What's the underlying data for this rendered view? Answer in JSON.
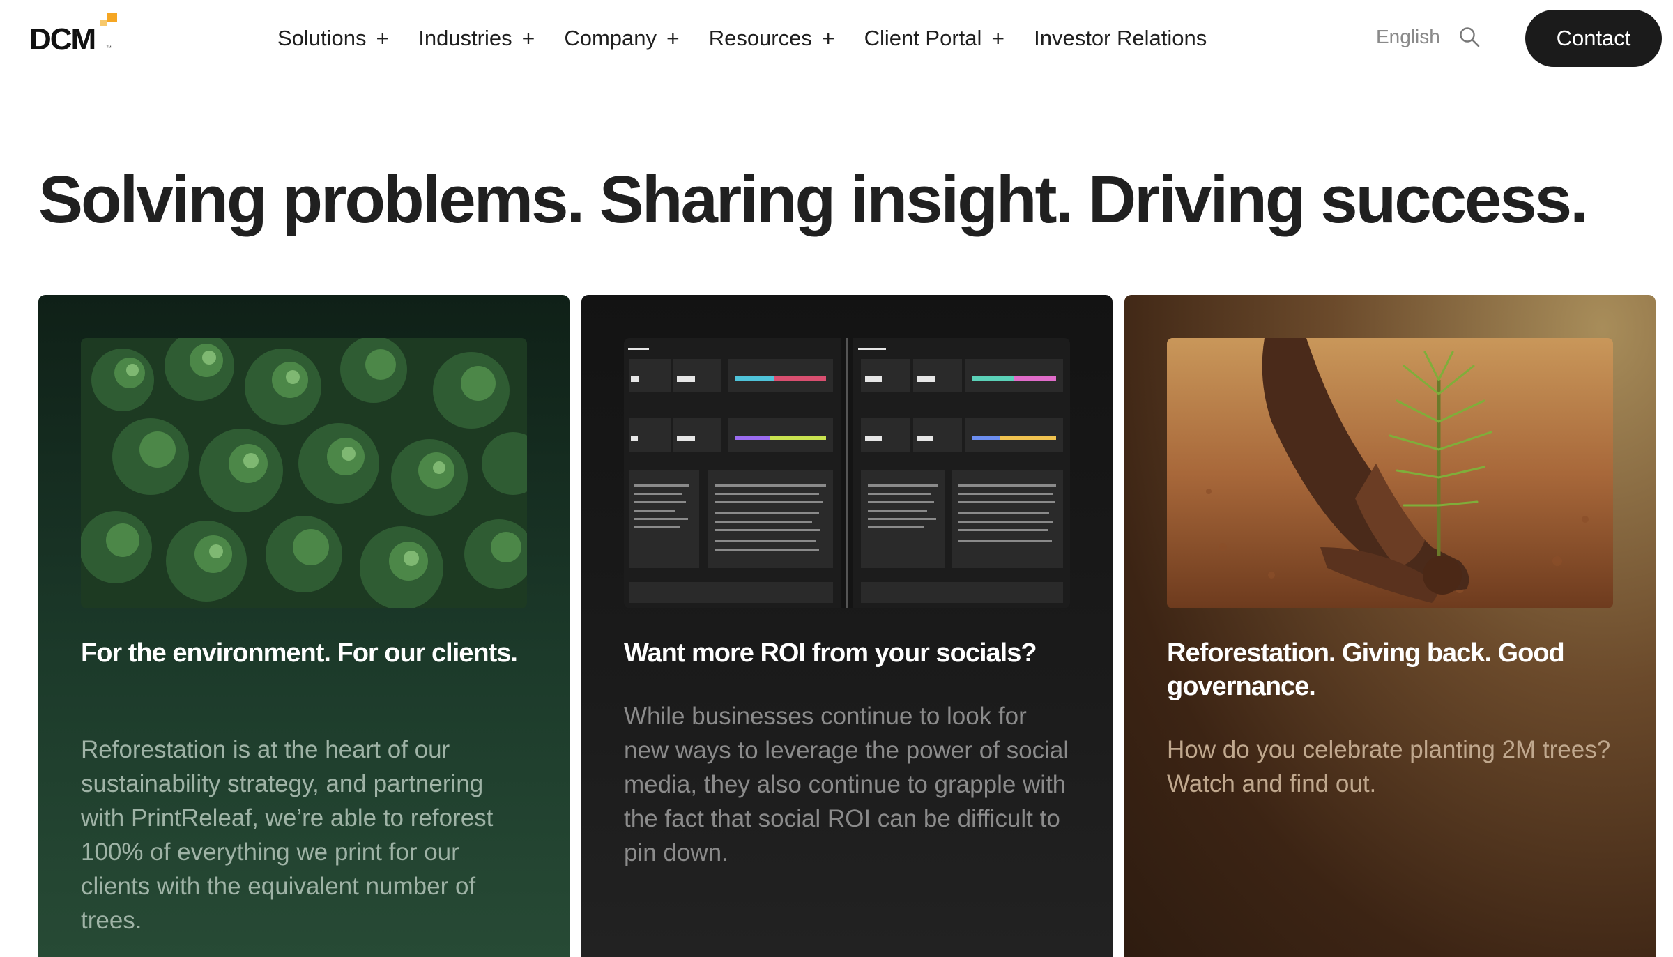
{
  "nav": {
    "logo": "DCM",
    "items": [
      {
        "label": "Solutions",
        "has_submenu": true
      },
      {
        "label": "Industries",
        "has_submenu": true
      },
      {
        "label": "Company",
        "has_submenu": true
      },
      {
        "label": "Resources",
        "has_submenu": true
      },
      {
        "label": "Client Portal",
        "has_submenu": true
      },
      {
        "label": "Investor Relations",
        "has_submenu": false
      }
    ],
    "language": "English",
    "contact_label": "Contact"
  },
  "hero": {
    "title": "Solving problems. Sharing insight. Driving success."
  },
  "cards": [
    {
      "title": "For the environment.  For our clients.",
      "description": "Reforestation is at the heart of our sustainability strategy, and partnering with PrintReleaf, we’re able to reforest 100% of everything we print for our clients with the equivalent number of trees.",
      "image": "aerial-forest"
    },
    {
      "title": "Want more ROI from your socials?",
      "description": "While businesses continue to look for new ways to leverage the power of social media, they also continue to grapple with the fact that social ROI can be difficult to pin down.",
      "image": "social-insights-report"
    },
    {
      "title": "Reforestation. Giving back. Good governance.",
      "description": "How do you celebrate planting 2M trees? Watch and find out.",
      "image": "hands-planting-sapling"
    }
  ],
  "colors": {
    "accent": "#f5a623",
    "contact_bg": "#1b1b1b"
  }
}
